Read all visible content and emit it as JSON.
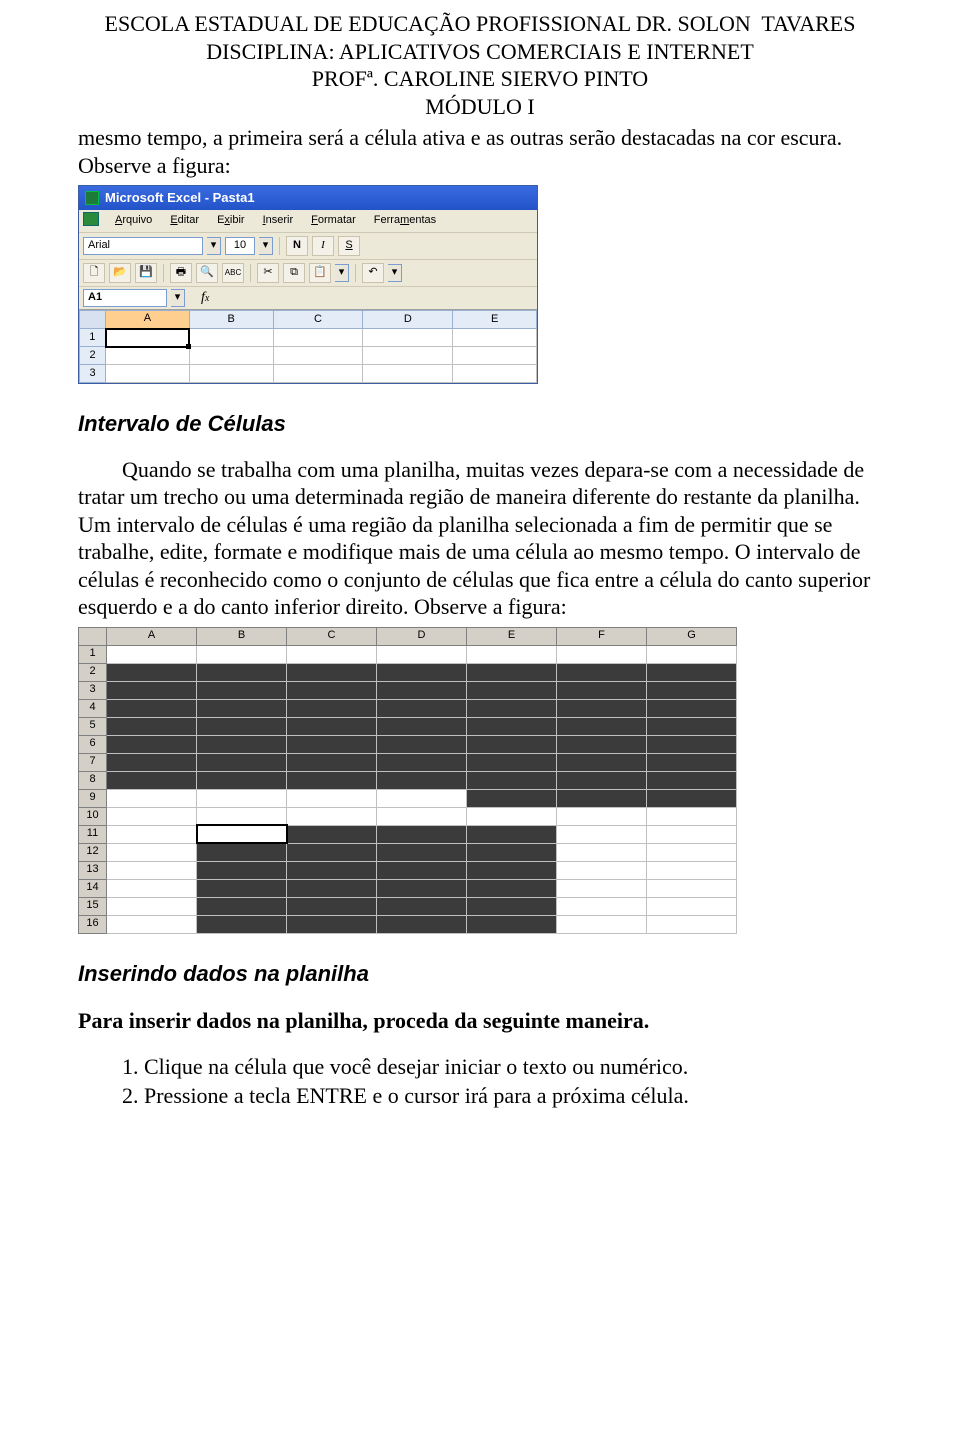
{
  "header": {
    "line1": "ESCOLA ESTADUAL DE EDUCAÇÃO PROFISSIONAL DR. SOLON  TAVARES",
    "line2": "DISCIPLINA: APLICATIVOS COMERCIAIS E INTERNET",
    "line3": "PROFª. CAROLINE SIERVO PINTO",
    "line4": "MÓDULO I"
  },
  "para1": "mesmo tempo, a primeira será a célula ativa e as outras serão destacadas na cor escura. Observe a figura:",
  "excel1": {
    "title": "Microsoft Excel - Pasta1",
    "menus": [
      "Arquivo",
      "Editar",
      "Exibir",
      "Inserir",
      "Formatar",
      "Ferramentas"
    ],
    "font_name": "Arial",
    "font_size": "10",
    "bold": "N",
    "italic": "I",
    "underline": "S",
    "namebox": "A1",
    "columns": [
      "A",
      "B",
      "C",
      "D",
      "E"
    ],
    "rows": [
      "1",
      "2",
      "3"
    ]
  },
  "section1_title": "Intervalo de Células",
  "para2": "Quando se trabalha com uma planilha, muitas vezes depara-se com a necessidade de tratar um trecho ou uma determinada região de maneira diferente do restante da planilha. Um intervalo de células é uma região da planilha selecionada a fim de permitir que se trabalhe, edite, formate e modifique mais de uma célula ao mesmo tempo. O intervalo de células é reconhecido como o conjunto de células que fica entre a célula do canto superior esquerdo e a do canto inferior direito. Observe a figura:",
  "grid2": {
    "columns": [
      "A",
      "B",
      "C",
      "D",
      "E",
      "F",
      "G"
    ],
    "rows": [
      "1",
      "2",
      "3",
      "4",
      "5",
      "6",
      "7",
      "8",
      "9",
      "10",
      "11",
      "12",
      "13",
      "14",
      "15",
      "16"
    ],
    "selections": {
      "block1": {
        "r1": 2,
        "r2": 8,
        "c1": "A",
        "c2": "D"
      },
      "block2": {
        "r1": 2,
        "r2": 9,
        "c1": "E",
        "c2": "G"
      },
      "block3": {
        "r1": 11,
        "r2": 16,
        "c1": "B",
        "c2": "E"
      },
      "active": {
        "r": 11,
        "c": "B"
      }
    }
  },
  "section2_title": "Inserindo dados na planilha",
  "subheading": "Para inserir dados na planilha, proceda da seguinte maneira.",
  "steps": [
    "Clique na célula que você desejar iniciar o texto ou numérico.",
    "Pressione a tecla ENTRE e o cursor irá para a próxima célula."
  ]
}
